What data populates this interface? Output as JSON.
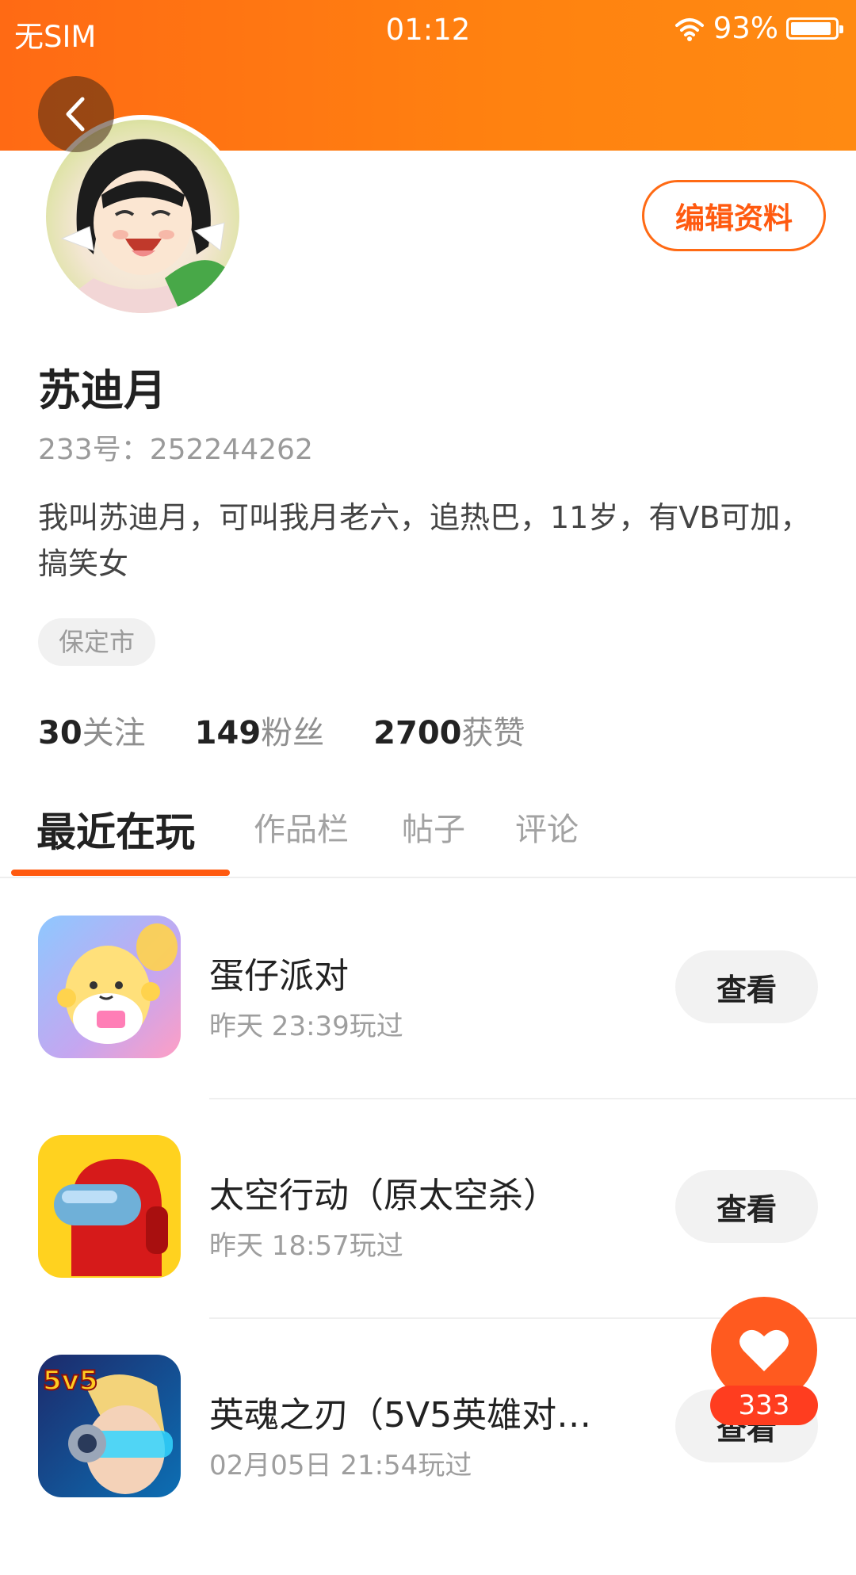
{
  "status_bar": {
    "carrier": "无SIM",
    "time": "01:12",
    "battery_percent": "93%",
    "battery_level": 0.93,
    "icons": [
      "wifi-icon",
      "battery-icon"
    ]
  },
  "header": {
    "back_icon": "chevron-left-icon",
    "accent_color": "#ff6a14"
  },
  "profile": {
    "edit_label": "编辑资料",
    "name": "苏迪月",
    "id_text": "233号：252244262",
    "bio": "我叫苏迪月，可叫我月老六，追热巴，11岁，有VB可加，搞笑女",
    "location": "保定市"
  },
  "stats": [
    {
      "num": "30",
      "label": "关注"
    },
    {
      "num": "149",
      "label": "粉丝"
    },
    {
      "num": "2700",
      "label": "获赞"
    }
  ],
  "tabs": [
    {
      "label": "最近在玩",
      "active": true
    },
    {
      "label": "作品栏",
      "active": false
    },
    {
      "label": "帖子",
      "active": false
    },
    {
      "label": "评论",
      "active": false
    }
  ],
  "games": [
    {
      "title": "蛋仔派对",
      "time": "昨天 23:39玩过",
      "button": "查看"
    },
    {
      "title": "太空行动（原太空杀）",
      "time": "昨天 18:57玩过",
      "button": "查看"
    },
    {
      "title": "英魂之刃（5V5英雄对…",
      "time": "02月05日 21:54玩过",
      "button": "查看",
      "icon_text": "5v5"
    }
  ],
  "fab": {
    "icon": "heart-icon",
    "count": "333"
  }
}
